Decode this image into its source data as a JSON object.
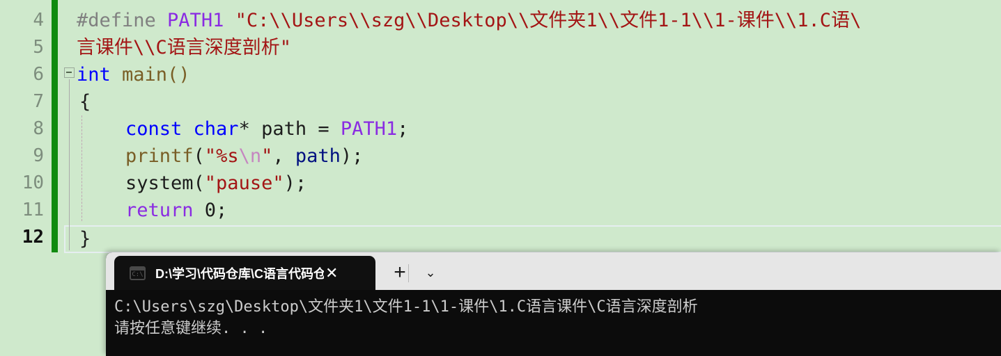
{
  "editor": {
    "background_color": "#cfe9cc",
    "change_marker_color": "#108a10",
    "line_numbers": [
      "4",
      "5",
      "6",
      "7",
      "8",
      "9",
      "10",
      "11",
      "12"
    ],
    "current_line_number": "12",
    "fold_icon": "fold-collapse-icon",
    "lines": [
      {
        "number": "4",
        "tokens": [
          {
            "text": "#define ",
            "kind": "preprocessor"
          },
          {
            "text": "PATH1 ",
            "kind": "macro-name"
          },
          {
            "text": "\"C:\\\\Users\\\\szg\\\\Desktop\\\\文件夹1\\\\文件1-1\\\\1-课件\\\\1.C语\\",
            "kind": "string"
          }
        ]
      },
      {
        "number": "5",
        "tokens": [
          {
            "text": "言课件\\\\C语言深度剖析\"",
            "kind": "string"
          }
        ]
      },
      {
        "number": "6",
        "tokens": [
          {
            "text": "int",
            "kind": "keyword"
          },
          {
            "text": " main()",
            "kind": "plain"
          }
        ]
      },
      {
        "number": "7",
        "tokens": [
          {
            "text": "{",
            "kind": "plain"
          }
        ]
      },
      {
        "number": "8",
        "tokens": [
          {
            "text": "const char",
            "kind": "keyword"
          },
          {
            "text": "* ",
            "kind": "plain"
          },
          {
            "text": "path",
            "kind": "plain"
          },
          {
            "text": " = ",
            "kind": "plain"
          },
          {
            "text": "PATH1",
            "kind": "macro-name"
          },
          {
            "text": ";",
            "kind": "plain"
          }
        ]
      },
      {
        "number": "9",
        "tokens": [
          {
            "text": "printf",
            "kind": "function"
          },
          {
            "text": "(",
            "kind": "plain"
          },
          {
            "text": "\"%s",
            "kind": "string"
          },
          {
            "text": "\\n",
            "kind": "escape"
          },
          {
            "text": "\"",
            "kind": "string"
          },
          {
            "text": ", ",
            "kind": "plain"
          },
          {
            "text": "path",
            "kind": "variable"
          },
          {
            "text": ");",
            "kind": "plain"
          }
        ]
      },
      {
        "number": "10",
        "tokens": [
          {
            "text": "system(",
            "kind": "plain"
          },
          {
            "text": "\"pause\"",
            "kind": "string"
          },
          {
            "text": ");",
            "kind": "plain"
          }
        ]
      },
      {
        "number": "11",
        "tokens": [
          {
            "text": "return",
            "kind": "keyword2"
          },
          {
            "text": " 0;",
            "kind": "plain"
          }
        ]
      },
      {
        "number": "12",
        "tokens": [
          {
            "text": "}",
            "kind": "plain"
          }
        ]
      }
    ]
  },
  "terminal": {
    "background_color": "#0c0c0c",
    "titlebar_color": "#e6e6e6",
    "tab": {
      "icon": "command-prompt-icon",
      "icon_label": "C:\\",
      "title": "D:\\学习\\代码仓库\\C语言代码仓",
      "close_label": "✕"
    },
    "new_tab_label": "+",
    "dropdown_label": "⌄",
    "output": [
      "C:\\Users\\szg\\Desktop\\文件夹1\\文件1-1\\1-课件\\1.C语言课件\\C语言深度剖析",
      "请按任意键继续. . ."
    ]
  }
}
